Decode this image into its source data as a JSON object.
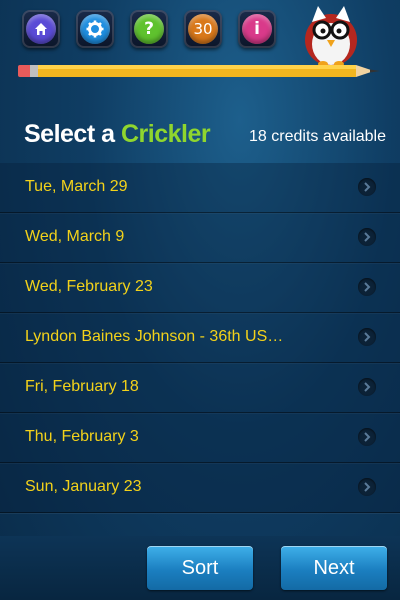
{
  "toolbar": {
    "timer_badge": "30",
    "colors": {
      "home": "#5a4bd6",
      "settings": "#1e8ee0",
      "help": "#5fc22e",
      "timer": "#d9781a",
      "info": "#d93a8a"
    }
  },
  "heading": {
    "select_a": "Select a",
    "crickler": "Crickler",
    "credits": "18 credits available"
  },
  "puzzles": [
    {
      "label": "Tue, March 29"
    },
    {
      "label": "Wed, March 9"
    },
    {
      "label": "Wed, February 23"
    },
    {
      "label": "Lyndon Baines Johnson - 36th US…"
    },
    {
      "label": "Fri, February 18"
    },
    {
      "label": "Thu, February 3"
    },
    {
      "label": "Sun, January 23"
    }
  ],
  "buttons": {
    "sort": "Sort",
    "next": "Next"
  },
  "colors": {
    "accent_green": "#8fd62e",
    "item_yellow": "#f3d21a",
    "button_blue": "#1b7fc0"
  }
}
